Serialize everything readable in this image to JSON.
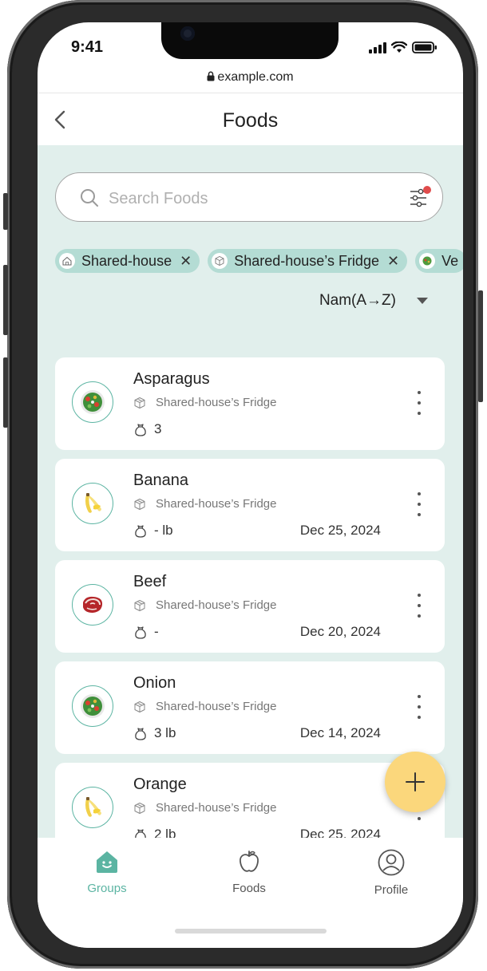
{
  "status_bar": {
    "time": "9:41"
  },
  "browser": {
    "url": "example.com"
  },
  "header": {
    "title": "Foods"
  },
  "search": {
    "placeholder": "Search Foods",
    "value": ""
  },
  "chips": [
    {
      "label": "Shared-house",
      "icon": "house-icon"
    },
    {
      "label": "Shared-house’s Fridge",
      "icon": "fridge-icon"
    },
    {
      "label": "Ve",
      "icon": "salad-icon"
    }
  ],
  "sort": {
    "label": "Nam(A→Z)"
  },
  "foods": [
    {
      "name": "Asparagus",
      "location": "Shared-house’s Fridge",
      "quantity": "3",
      "date": "",
      "icon": "salad-icon"
    },
    {
      "name": "Banana",
      "location": "Shared-house’s Fridge",
      "quantity": "- lb",
      "date": "Dec 25, 2024",
      "icon": "banana-icon"
    },
    {
      "name": "Beef",
      "location": "Shared-house’s Fridge",
      "quantity": "-",
      "date": "Dec 20, 2024",
      "icon": "steak-icon"
    },
    {
      "name": "Onion",
      "location": "Shared-house’s Fridge",
      "quantity": "3 lb",
      "date": "Dec 14, 2024",
      "icon": "salad-icon"
    },
    {
      "name": "Orange",
      "location": "Shared-house’s Fridge",
      "quantity": "2 lb",
      "date": "Dec 25, 2024",
      "icon": "banana-icon"
    }
  ],
  "tabs": [
    {
      "label": "Groups",
      "icon": "groups-home-icon",
      "active": true
    },
    {
      "label": "Foods",
      "icon": "apple-icon",
      "active": false
    },
    {
      "label": "Profile",
      "icon": "profile-icon",
      "active": false
    }
  ],
  "colors": {
    "accent": "#5bb4a2",
    "background": "#e1efec",
    "chip": "#b4dcd4",
    "fab": "#fbd77c",
    "badge": "#e04c4c"
  }
}
